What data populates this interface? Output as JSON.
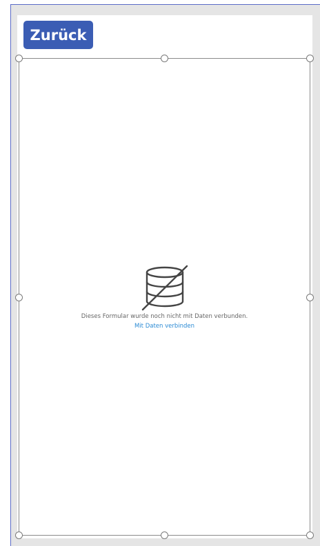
{
  "header": {
    "back_label": "Zurück"
  },
  "form": {
    "empty_message": "Dieses Formular wurde noch nicht mit Daten verbunden.",
    "connect_link": "Mit Daten verbinden"
  },
  "icons": {
    "empty_state": "database-disconnected-icon"
  },
  "colors": {
    "button_bg": "#3b5db4",
    "link": "#2a8ad4",
    "frame_bg": "#e5e5e5",
    "frame_border": "#5a6bc7"
  }
}
